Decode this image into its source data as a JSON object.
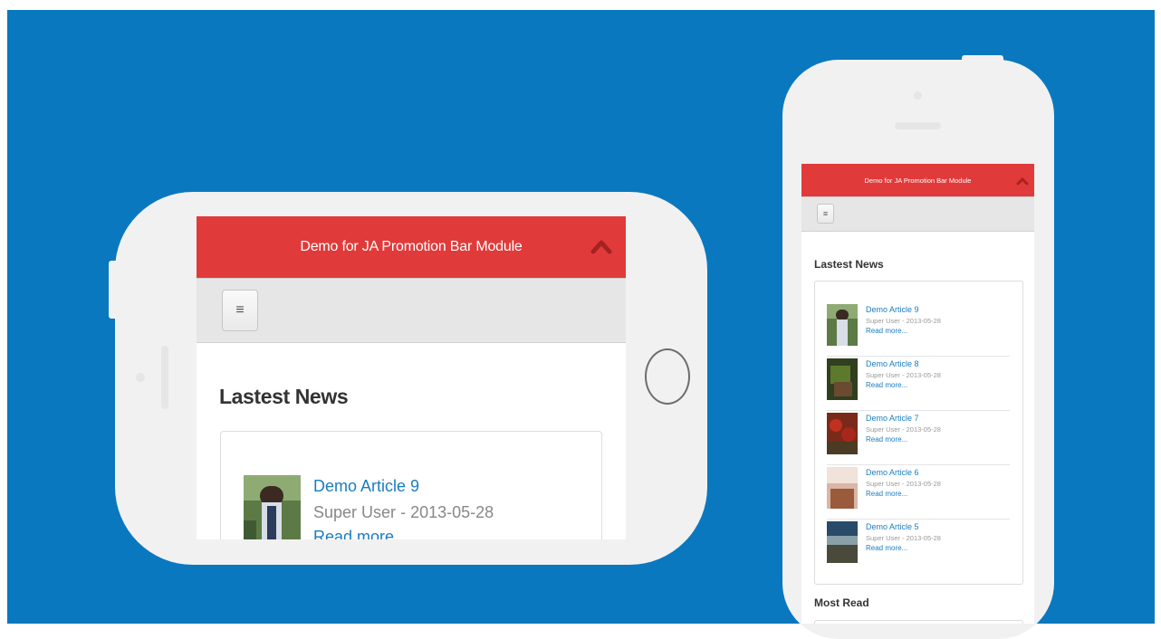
{
  "colors": {
    "background": "#0a78be",
    "promo_bar": "#e13a3a",
    "link": "#1a7dc0",
    "phone_body": "#f1f1f1"
  },
  "landscape": {
    "promo_text": "Demo for JA Promotion Bar Module",
    "menu_icon": "hamburger-icon",
    "section_title": "Lastest News",
    "article": {
      "title": "Demo Article 9",
      "author": "Super User",
      "separator": "-",
      "date": "2013-05-28",
      "read_more": "Read more..."
    }
  },
  "portrait": {
    "promo_text": "Demo for JA Promotion Bar Module",
    "menu_icon": "hamburger-icon",
    "section_title": "Lastest News",
    "articles": [
      {
        "title": "Demo Article 9",
        "meta": "Super User - 2013-05-28",
        "read_more": "Read more..."
      },
      {
        "title": "Demo Article 8",
        "meta": "Super User - 2013-05-28",
        "read_more": "Read more..."
      },
      {
        "title": "Demo Article 7",
        "meta": "Super User - 2013-05-28",
        "read_more": "Read more..."
      },
      {
        "title": "Demo Article 6",
        "meta": "Super User - 2013-05-28",
        "read_more": "Read more..."
      },
      {
        "title": "Demo Article 5",
        "meta": "Super User - 2013-05-28",
        "read_more": "Read more..."
      }
    ],
    "second_section_title": "Most Read"
  }
}
